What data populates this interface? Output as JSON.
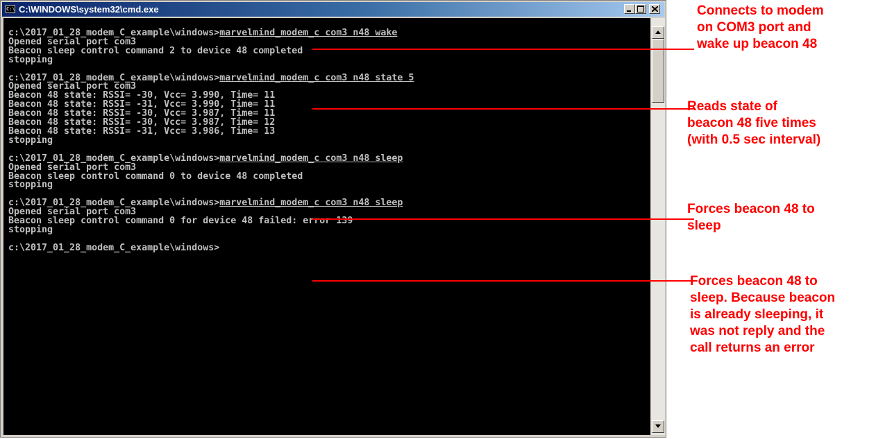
{
  "window": {
    "title": "C:\\WINDOWS\\system32\\cmd.exe",
    "icon": "cmd-icon",
    "controls": [
      "minimize",
      "maximize",
      "close"
    ]
  },
  "console": {
    "text_color": "#c0c0c0",
    "background": "#000000",
    "blocks": [
      {
        "prompt": "c:\\2017_01_28_modem_C_example\\windows>",
        "command": "marvelmind_modem_c com3 n48 wake",
        "output": [
          "Opened serial port com3",
          "Beacon sleep control command 2 to device 48 completed",
          "stopping"
        ]
      },
      {
        "prompt": "c:\\2017_01_28_modem_C_example\\windows>",
        "command": "marvelmind_modem_c com3 n48 state 5",
        "output": [
          "Opened serial port com3",
          "Beacon 48 state: RSSI= -30, Vcc= 3.990, Time= 11",
          "Beacon 48 state: RSSI= -31, Vcc= 3.990, Time= 11",
          "Beacon 48 state: RSSI= -30, Vcc= 3.987, Time= 11",
          "Beacon 48 state: RSSI= -30, Vcc= 3.987, Time= 12",
          "Beacon 48 state: RSSI= -31, Vcc= 3.986, Time= 13",
          "stopping"
        ]
      },
      {
        "prompt": "c:\\2017_01_28_modem_C_example\\windows>",
        "command": "marvelmind_modem_c com3 n48 sleep",
        "output": [
          "Opened serial port com3",
          "Beacon sleep control command 0 to device 48 completed",
          "stopping"
        ]
      },
      {
        "prompt": "c:\\2017_01_28_modem_C_example\\windows>",
        "command": "marvelmind_modem_c com3 n48 sleep",
        "output": [
          "Opened serial port com3",
          "Beacon sleep control command 0 for device 48 failed: error 139",
          "stopping"
        ]
      }
    ],
    "final_prompt": "c:\\2017_01_28_modem_C_example\\windows>"
  },
  "annotations": {
    "color": "#ff0000",
    "items": [
      {
        "text": "Connects to modem\non COM3 port and\nwake up beacon 48"
      },
      {
        "text": "Reads state of\nbeacon 48 five times\n(with 0.5 sec interval)"
      },
      {
        "text": "Forces beacon 48 to\nsleep"
      },
      {
        "text": "Forces beacon 48 to\nsleep. Because beacon\nis already sleeping, it\nwas not reply and the\ncall returns an error"
      }
    ]
  }
}
